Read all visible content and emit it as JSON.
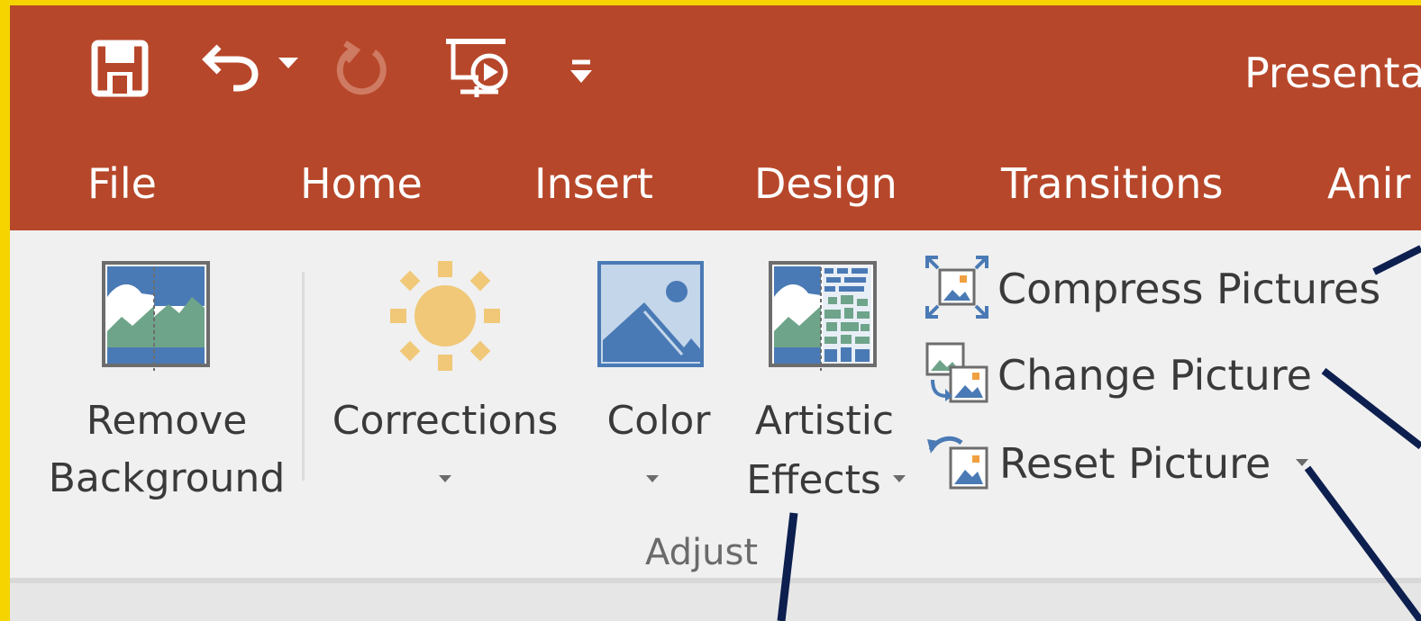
{
  "window": {
    "title": "Presenta"
  },
  "quick_access": {
    "items": [
      "save-icon",
      "undo-icon",
      "undo-dropdown-icon",
      "redo-icon",
      "start-from-beginning-icon",
      "customize-qat-icon"
    ]
  },
  "tabs": [
    {
      "label": "File"
    },
    {
      "label": "Home"
    },
    {
      "label": "Insert"
    },
    {
      "label": "Design"
    },
    {
      "label": "Transitions"
    },
    {
      "label": "Anir"
    }
  ],
  "ribbon": {
    "remove_background": {
      "line1": "Remove",
      "line2": "Background"
    },
    "corrections": {
      "label": "Corrections"
    },
    "color": {
      "label": "Color"
    },
    "artistic_effects": {
      "line1": "Artistic",
      "line2": "Effects"
    },
    "compress_pictures": {
      "label": "Compress Pictures"
    },
    "change_picture": {
      "label": "Change Picture"
    },
    "reset_picture": {
      "label": "Reset Picture"
    },
    "group_label": "Adjust"
  },
  "colors": {
    "title_bar": "#b7472a",
    "ribbon_bg": "#f0f0f0",
    "frame_border": "#f5d400",
    "callout_line": "#0d1f4f",
    "picture_blue": "#4a7ab5",
    "picture_green": "#6ea48a",
    "sun": "#f0c878"
  }
}
